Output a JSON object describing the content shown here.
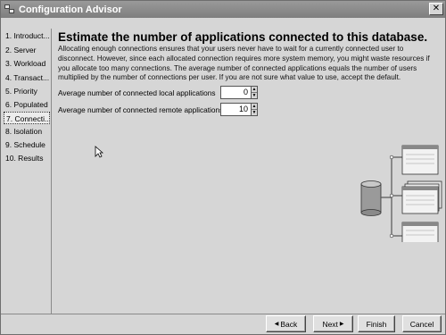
{
  "window": {
    "title": "Configuration Advisor",
    "close_symbol": "✕"
  },
  "sidebar": {
    "items": [
      {
        "label": "1. Introduct..."
      },
      {
        "label": "2. Server"
      },
      {
        "label": "3. Workload"
      },
      {
        "label": "4. Transact..."
      },
      {
        "label": "5. Priority"
      },
      {
        "label": "6. Populated"
      },
      {
        "label": "7. Connecti...",
        "selected": true
      },
      {
        "label": "8. Isolation"
      },
      {
        "label": "9. Schedule"
      },
      {
        "label": "10. Results"
      }
    ]
  },
  "main": {
    "heading": "Estimate the number of applications connected to this database.",
    "description": "Allocating enough connections ensures that your users never have to wait for a currently connected user to disconnect. However, since each allocated connection requires more system memory, you might waste resources if you allocate too many connections. The average number of connected applications equals the number of users multiplied by the number of connections per user. If you are not sure what value to use, accept the default.",
    "local": {
      "label": "Average number of connected local applications",
      "value": "0"
    },
    "remote": {
      "label": "Average number of connected remote applications",
      "value": "10"
    },
    "illustration_icons": [
      "database-cylinder-icon",
      "client-window-icon"
    ]
  },
  "footer": {
    "back_label": "Back",
    "next_label": "Next",
    "finish_label": "Finish",
    "cancel_label": "Cancel"
  },
  "colors": {
    "titlebar": "#888888",
    "background": "#d6d6d6"
  }
}
